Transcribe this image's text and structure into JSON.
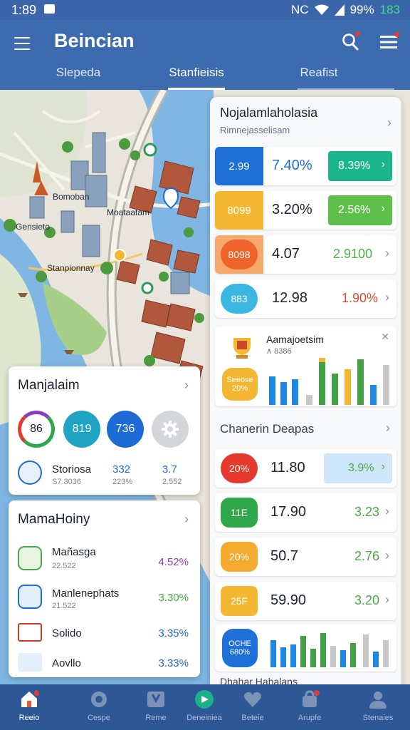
{
  "status": {
    "time": "1:89",
    "network": "NC",
    "signal": "99%",
    "battery": "183"
  },
  "header": {
    "title": "Beincian",
    "tabs": [
      "Slepeda",
      "Stanfieisis",
      "Reafist"
    ]
  },
  "map": {
    "labels": [
      "Bomoban",
      "Gensieto",
      "Moataatam",
      "Stanpionnay"
    ]
  },
  "right_panel": {
    "title": "Nojalamlaholasia",
    "subtitle": "Rimnejasselisam",
    "rows_a": [
      {
        "pill": "2.99",
        "value": "7.40%",
        "right": "8.39%",
        "pill_color": "#1f6fd8",
        "right_color": "#1ab58a"
      },
      {
        "pill": "8099",
        "value": "3.20%",
        "right": "2.56%",
        "pill_color": "#f4b731",
        "right_color": "#5ec04a"
      },
      {
        "pill": "8098",
        "value": "4.07",
        "right": "2.9100",
        "pill_color": "#f0632a",
        "right_color": "#4db34a"
      },
      {
        "pill": "883",
        "value": "12.98",
        "right": "1.90%",
        "pill_color": "#3ab8e2",
        "right_color": "#e04b2d"
      }
    ],
    "chart_card": {
      "title": "Aamajoetsim",
      "sub": "∧ 8386",
      "badge": "Seeose 20%"
    },
    "section2": "Chanerin Deapas",
    "rows_b": [
      {
        "pill": "20%",
        "value": "11.80",
        "right": "3.9%",
        "pill_color": "#e53b2e",
        "right_color": "#4aa84a"
      },
      {
        "pill": "11E",
        "value": "17.90",
        "right": "3.23",
        "pill_color": "#2fa84a",
        "right_color": "#4aa84a"
      },
      {
        "pill": "20%",
        "value": "50.7",
        "right": "2.76",
        "pill_color": "#f4a92f",
        "right_color": "#4aa84a"
      },
      {
        "pill": "25F",
        "value": "59.90",
        "right": "3.20",
        "pill_color": "#f4b731",
        "right_color": "#4aa84a"
      }
    ],
    "chart2_badge": "OCHE 680%",
    "section3": "Dhahar Hahalans"
  },
  "card1": {
    "title": "Manjalaim",
    "rings": [
      "86",
      "819",
      "736"
    ],
    "item_label": "Storiosa",
    "item_sub": "S7.3036",
    "col1": "332",
    "col1_sub": "223%",
    "col2": "3.7",
    "col2_sub": "2.552"
  },
  "card2": {
    "title": "MamaHoiny",
    "items": [
      {
        "label": "Mañasga",
        "sub": "22.522",
        "value": "4.52%",
        "color": "#8f3cc4"
      },
      {
        "label": "Manlenephats",
        "sub": "21.522",
        "value": "3.30%",
        "color": "#4aa84a"
      },
      {
        "label": "Solido",
        "sub": "",
        "value": "3.35%",
        "color": "#1e6bd6"
      },
      {
        "label": "Aovllo",
        "sub": "",
        "value": "3.33%",
        "color": "#1e6bd6"
      }
    ]
  },
  "bottom_nav": [
    "Reeio",
    "Cespe",
    "Reme",
    "Deneiniea",
    "Beteie",
    "Arupfe",
    "Stenaies"
  ]
}
